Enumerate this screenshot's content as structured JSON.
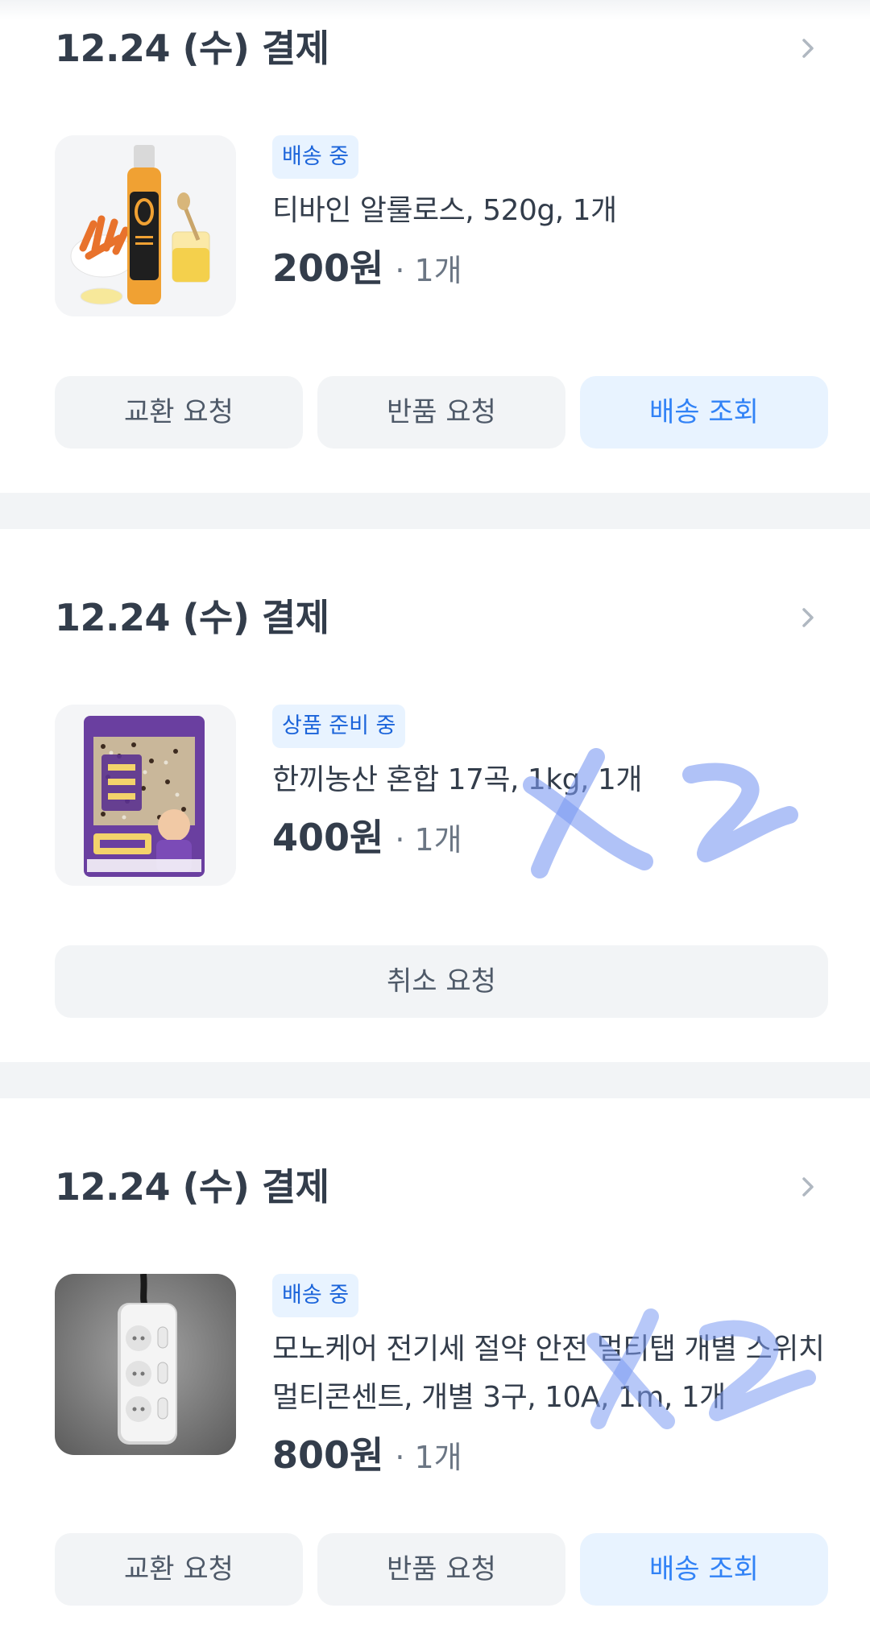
{
  "orders": [
    {
      "date": "12.24 (수) 결제",
      "status": "배송 중",
      "product_name": "티바인 알룰로스, 520g, 1개",
      "price": "200원",
      "quantity": "· 1개",
      "buttons": [
        "교환 요청",
        "반품 요청",
        "배송 조회"
      ]
    },
    {
      "date": "12.24 (수) 결제",
      "status": "상품 준비 중",
      "product_name": "한끼농산 혼합 17곡, 1kg, 1개",
      "price": "400원",
      "quantity": "· 1개",
      "buttons": [
        "취소 요청"
      ]
    },
    {
      "date": "12.24 (수) 결제",
      "status": "배송 중",
      "product_name": "모노케어 전기세 절약 안전 멀티탭 개별 스위치 멀티콘센트, 개별 3구, 10A, 1m, 1개",
      "price": "800원",
      "quantity": "· 1개",
      "buttons": [
        "교환 요청",
        "반품 요청",
        "배송 조회"
      ]
    }
  ],
  "annotations": [
    "x2",
    "x2"
  ],
  "colors": {
    "badge_bg": "#e8f3ff",
    "badge_text": "#1b64da",
    "primary_button_text": "#3182f6",
    "divider": "#f2f4f6",
    "annotation_ink": "#7c9af2"
  }
}
